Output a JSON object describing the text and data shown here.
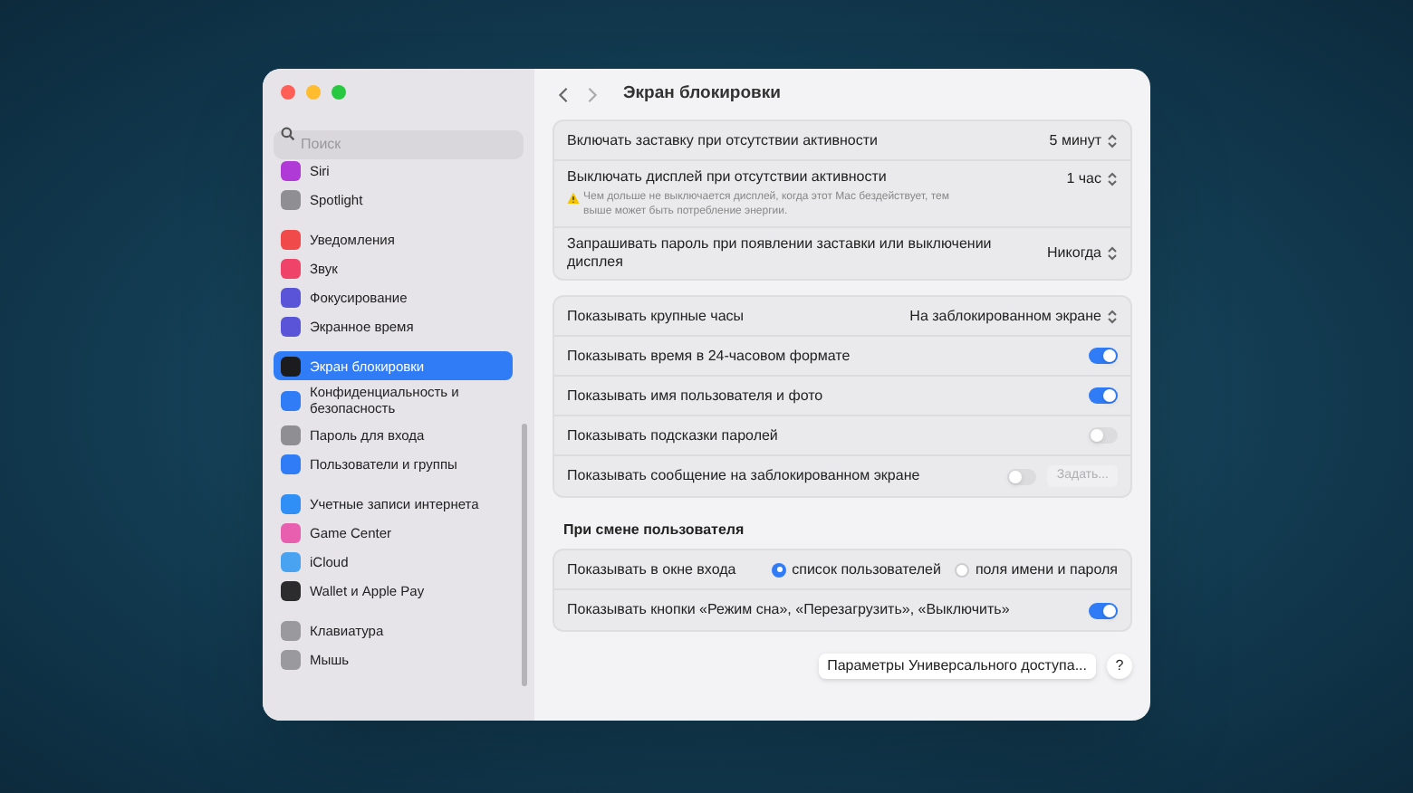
{
  "sidebar": {
    "search": {
      "placeholder": "Поиск"
    },
    "groups": [
      {
        "items": [
          {
            "label": "Siri",
            "color": "#b03ad6",
            "selected": false
          },
          {
            "label": "Spotlight",
            "color": "#8e8e93",
            "selected": false
          }
        ]
      },
      {
        "items": [
          {
            "label": "Уведомления",
            "color": "#f04a4a",
            "selected": false
          },
          {
            "label": "Звук",
            "color": "#f0436a",
            "selected": false
          },
          {
            "label": "Фокусирование",
            "color": "#5a55d8",
            "selected": false
          },
          {
            "label": "Экранное время",
            "color": "#5a55d8",
            "selected": false
          }
        ]
      },
      {
        "items": [
          {
            "label": "Экран блокировки",
            "color": "#1c1c1e",
            "selected": true
          },
          {
            "label": "Конфиденциальность и безопасность",
            "color": "#2f7cf6",
            "selected": false
          },
          {
            "label": "Пароль для входа",
            "color": "#8e8e93",
            "selected": false
          },
          {
            "label": "Пользователи и группы",
            "color": "#2f7cf6",
            "selected": false
          }
        ]
      },
      {
        "items": [
          {
            "label": "Учетные записи интернета",
            "color": "#2f8ff6",
            "selected": false
          },
          {
            "label": "Game Center",
            "color": "#e85fb0",
            "selected": false
          },
          {
            "label": "iCloud",
            "color": "#4aa3f0",
            "selected": false
          },
          {
            "label": "Wallet и Apple Pay",
            "color": "#2c2c2e",
            "selected": false
          }
        ]
      },
      {
        "items": [
          {
            "label": "Клавиатура",
            "color": "#9a9a9e",
            "selected": false
          },
          {
            "label": "Мышь",
            "color": "#9a9a9e",
            "selected": false
          }
        ]
      }
    ]
  },
  "header": {
    "title": "Экран блокировки"
  },
  "sections": [
    {
      "rows": [
        {
          "kind": "popup",
          "label": "Включать заставку при отсутствии активности",
          "value": "5 минут"
        },
        {
          "kind": "popup",
          "label": "Выключать дисплей при отсутствии активности",
          "note": "Чем дольше не выключается дисплей, когда этот Mac бездействует, тем выше может быть потребление энергии.",
          "value": "1 час"
        },
        {
          "kind": "popup",
          "label": "Запрашивать пароль при появлении заставки или выключении дисплея",
          "value": "Никогда"
        }
      ]
    },
    {
      "rows": [
        {
          "kind": "popup",
          "label": "Показывать крупные часы",
          "value": "На заблокированном экране"
        },
        {
          "kind": "toggle",
          "label": "Показывать время в 24-часовом формате",
          "on": true
        },
        {
          "kind": "toggle",
          "label": "Показывать имя пользователя и фото",
          "on": true
        },
        {
          "kind": "toggle",
          "label": "Показывать подсказки паролей",
          "on": false
        },
        {
          "kind": "toggle",
          "label": "Показывать сообщение на заблокированном экране",
          "on": false,
          "button": {
            "label": "Задать...",
            "disabled": true
          }
        }
      ]
    },
    {
      "heading": "При смене пользователя",
      "rows": [
        {
          "kind": "radio",
          "label": "Показывать в окне входа",
          "options": [
            {
              "label": "список пользователей",
              "selected": true
            },
            {
              "label": "поля имени и пароля",
              "selected": false
            }
          ]
        },
        {
          "kind": "toggle",
          "label": "Показывать кнопки «Режим сна», «Перезагрузить», «Выключить»",
          "on": true
        }
      ]
    }
  ],
  "footer": {
    "button": "Параметры Универсального доступа...",
    "help": "?"
  }
}
